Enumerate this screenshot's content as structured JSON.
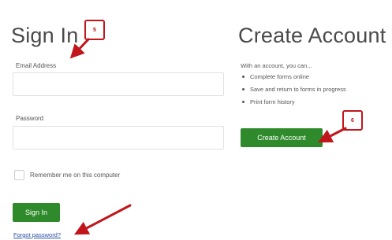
{
  "signin": {
    "title": "Sign In",
    "email_label": "Email Address",
    "email_value": "",
    "email_placeholder": "",
    "password_label": "Password",
    "password_value": "",
    "password_placeholder": "",
    "remember_label": "Remember me on this computer",
    "remember_checked": false,
    "button_label": "Sign In",
    "forgot_label": "Forgot password?"
  },
  "create": {
    "title": "Create Account",
    "intro": "With an account, you can...",
    "features": [
      "Complete forms online",
      "Save and return to forms in progress",
      "Print form history"
    ],
    "button_label": "Create Account"
  },
  "annotations": {
    "signin_marker": "5",
    "create_marker": "6"
  },
  "colors": {
    "button_green": "#2f8a2b",
    "annotation_red": "#c0161c",
    "link_blue": "#2a4fa3"
  }
}
